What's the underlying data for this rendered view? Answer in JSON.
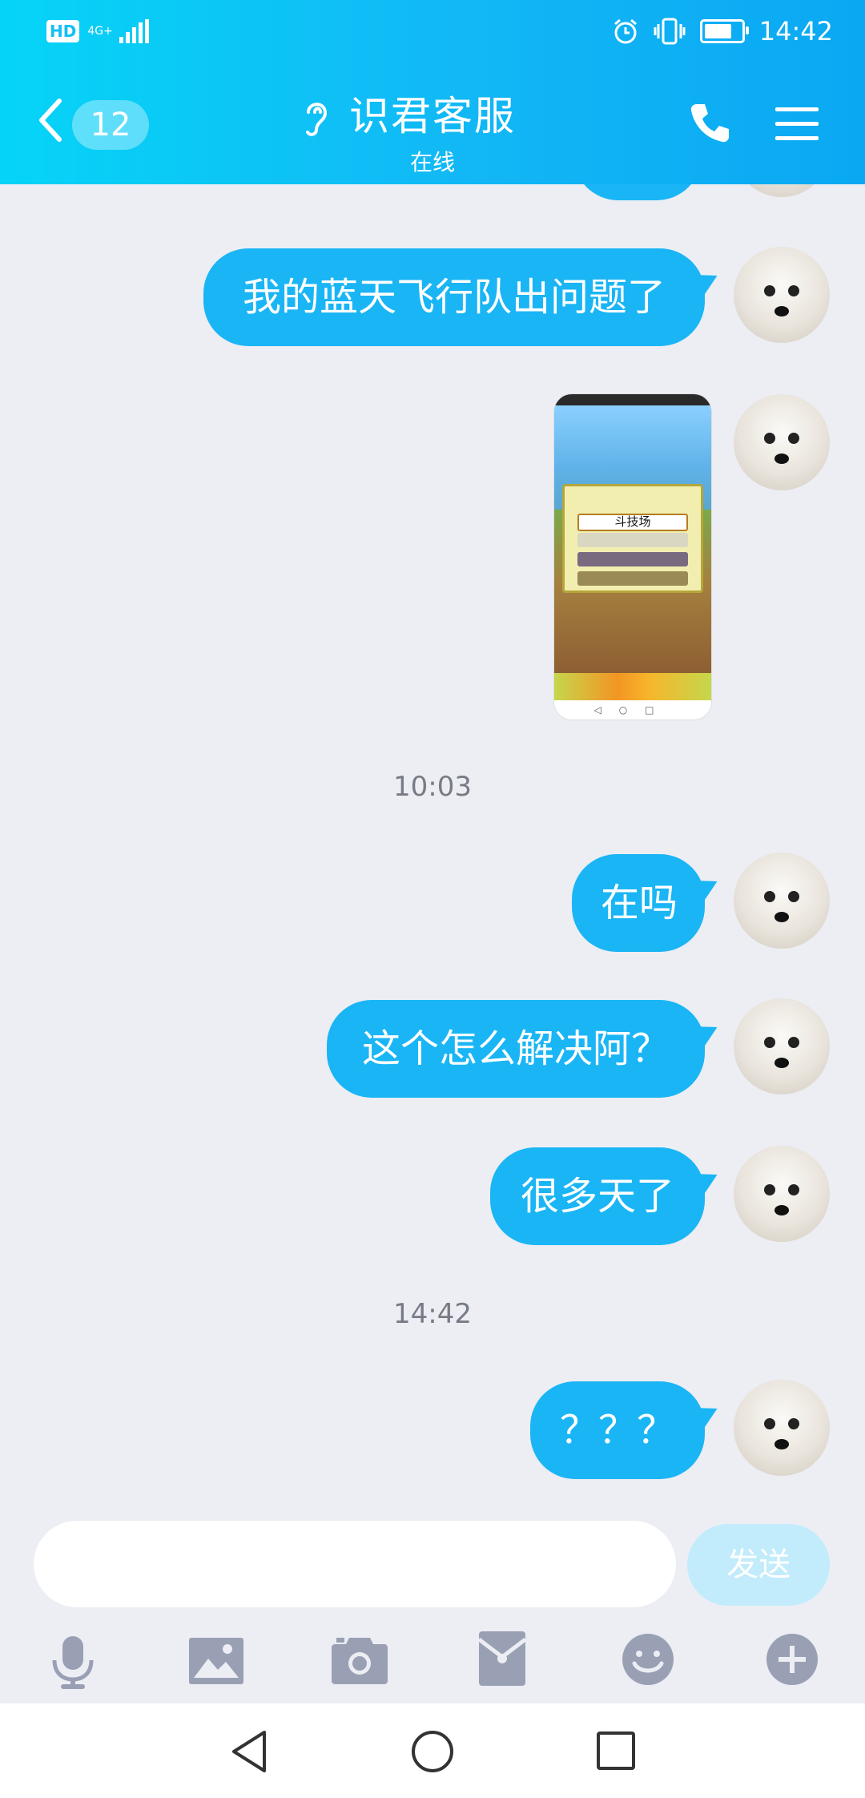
{
  "status_bar": {
    "time": "14:42",
    "hd_label": "HD",
    "network_label": "4G+",
    "battery_percent": 75
  },
  "header": {
    "unread_count": "12",
    "title": "识君客服",
    "subtitle": "在线"
  },
  "messages": [
    {
      "type": "text",
      "text": "我的蓝天飞行队出问题了"
    },
    {
      "type": "image",
      "caption_in_image": "斗技场"
    },
    {
      "type": "timestamp",
      "text": "10:03"
    },
    {
      "type": "text",
      "text": "在吗"
    },
    {
      "type": "text",
      "text": "这个怎么解决阿？"
    },
    {
      "type": "text",
      "text": "很多天了"
    },
    {
      "type": "timestamp",
      "text": "14:42"
    },
    {
      "type": "text",
      "text": "？？？"
    }
  ],
  "composer": {
    "input_value": "",
    "send_label": "发送",
    "tools": [
      "microphone-icon",
      "image-icon",
      "camera-icon",
      "red-packet-icon",
      "emoji-icon",
      "plus-icon"
    ]
  },
  "colors": {
    "header_start": "#06d4f7",
    "header_end": "#0aa8f3",
    "bubble": "#1ab5f5",
    "background": "#eceef4",
    "send_disabled": "#c2ecfb",
    "tool_icon": "#9aa0b4"
  }
}
